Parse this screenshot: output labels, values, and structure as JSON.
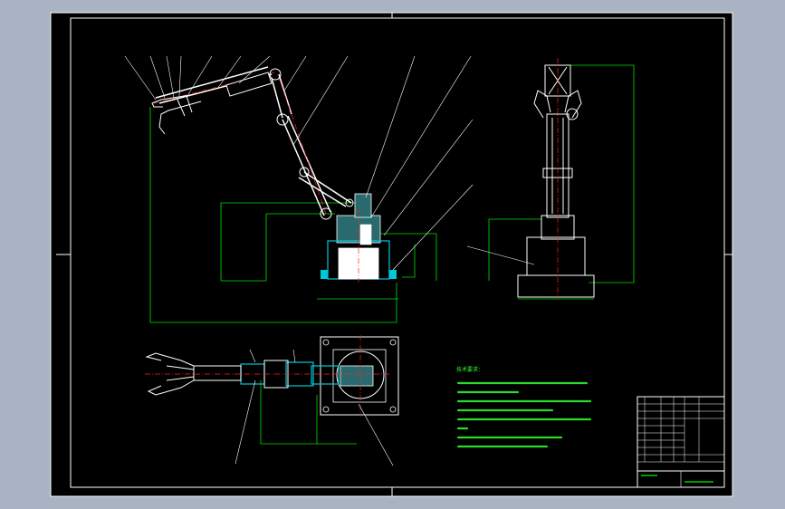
{
  "colors": {
    "viewport_background": "#a9b3c3",
    "sheet": "#000000",
    "outline": "#ffffff",
    "dimension": "#00e000",
    "center_line": "#ff2020",
    "hatch_body": "#2a6a6e",
    "cyan_parts": "#00c8d8",
    "note_text": "#33ff33"
  },
  "technical_notes": {
    "lines": [
      "技术要求：",
      "",
      "",
      "",
      "",
      "",
      ""
    ]
  },
  "title_block": {
    "cells": [
      "",
      "",
      "",
      ""
    ]
  },
  "balloons": [
    "",
    "",
    "",
    "",
    "",
    "",
    "",
    "",
    "",
    "",
    "",
    "",
    "",
    "",
    ""
  ],
  "dimensions": [
    "",
    "",
    "",
    "",
    "",
    "",
    "",
    ""
  ]
}
